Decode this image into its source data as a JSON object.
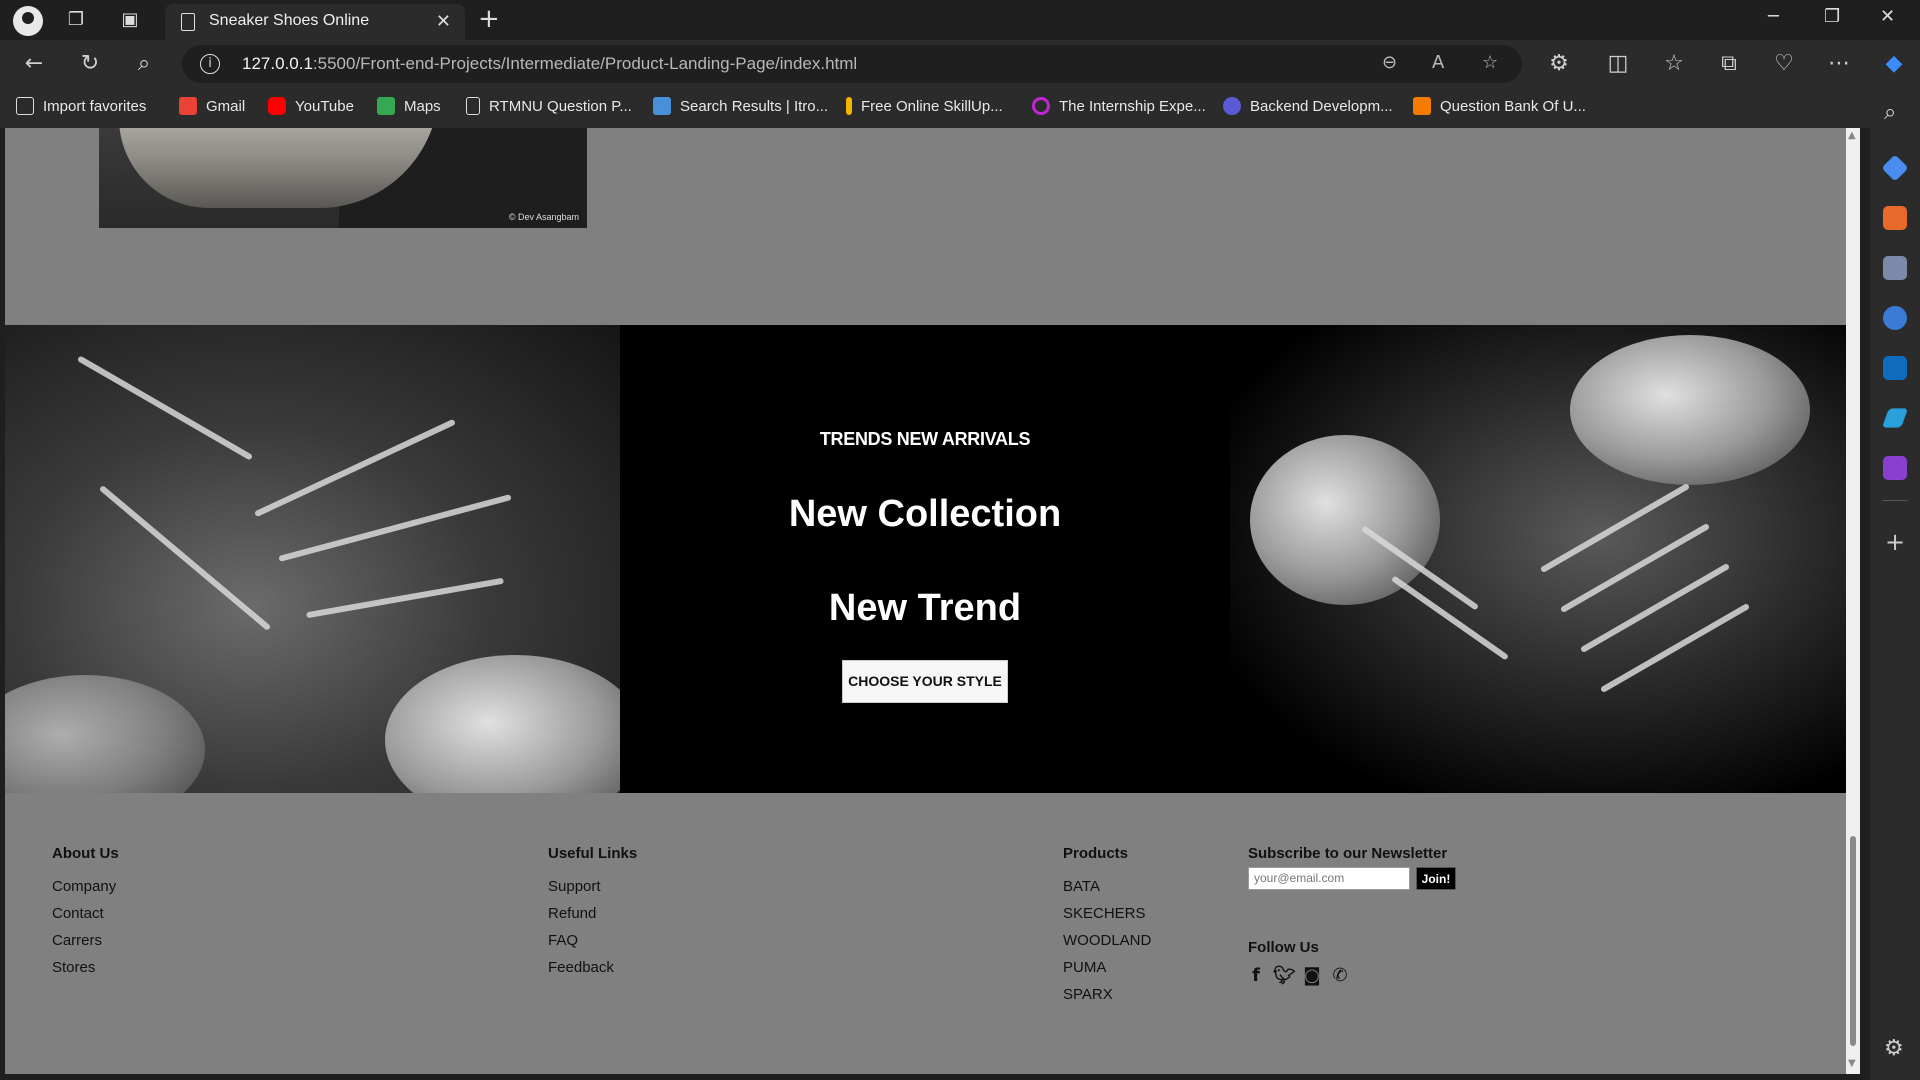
{
  "browser": {
    "tab_title": "Sneaker Shoes Online",
    "url_host": "127.0.0.1",
    "url_rest": ":5500/Front-end-Projects/Intermediate/Product-Landing-Page/index.html"
  },
  "bookmarks": [
    {
      "label": "Import favorites",
      "color": "#e0e0e0"
    },
    {
      "label": "Gmail",
      "color": "#ea4335"
    },
    {
      "label": "YouTube",
      "color": "#ff0000"
    },
    {
      "label": "Maps",
      "color": "#34a853"
    },
    {
      "label": "RTMNU Question P...",
      "color": "#e0e0e0"
    },
    {
      "label": "Search Results | Itro...",
      "color": "#4a90d9"
    },
    {
      "label": "Free Online SkillUp...",
      "color": "#f4b400"
    },
    {
      "label": "The Internship Expe...",
      "color": "#c026d3"
    },
    {
      "label": "Backend Developm...",
      "color": "#5b5bd6"
    },
    {
      "label": "Question Bank Of U...",
      "color": "#f57c00"
    }
  ],
  "page": {
    "photo_credit": "© Dev Asangbam",
    "hero": {
      "subtitle": "TRENDS NEW ARRIVALS",
      "heading1": "New Collection",
      "heading2": "New Trend",
      "button": "CHOOSE YOUR STYLE"
    },
    "footer": {
      "about": {
        "title": "About Us",
        "links": [
          "Company",
          "Contact",
          "Carrers",
          "Stores"
        ]
      },
      "useful": {
        "title": "Useful Links",
        "links": [
          "Support",
          "Refund",
          "FAQ",
          "Feedback"
        ]
      },
      "products": {
        "title": "Products",
        "links": [
          "BATA",
          "SKECHERS",
          "WOODLAND",
          "PUMA",
          "SPARX"
        ]
      },
      "newsletter": {
        "title": "Subscribe to our Newsletter",
        "placeholder": "your@email.com",
        "button": "Join!"
      },
      "follow": {
        "title": "Follow Us",
        "icons": [
          "facebook-icon",
          "twitter-icon",
          "instagram-icon",
          "whatsapp-icon"
        ]
      }
    }
  }
}
